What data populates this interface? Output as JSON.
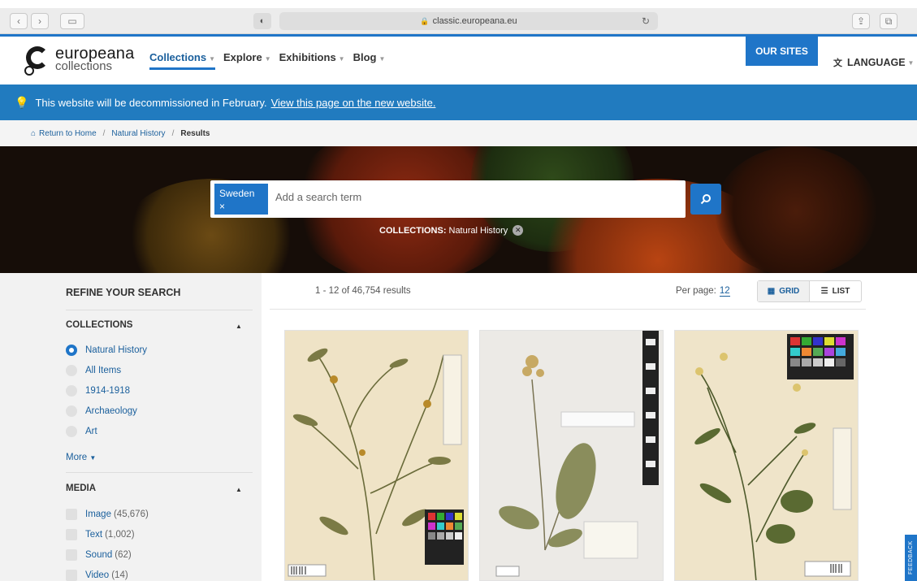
{
  "browser": {
    "url": "classic.europeana.eu",
    "back_icon": "chevron-left-icon",
    "forward_icon": "chevron-right-icon"
  },
  "header": {
    "logo_line1": "europeana",
    "logo_line2": "collections",
    "nav": [
      {
        "label": "Collections"
      },
      {
        "label": "Explore"
      },
      {
        "label": "Exhibitions"
      },
      {
        "label": "Blog"
      }
    ],
    "our_sites": "OUR SITES",
    "language": "LANGUAGE"
  },
  "banner": {
    "text": "This website will be decommissioned in February.",
    "link": "View this page on the new website."
  },
  "breadcrumb": {
    "home": "Return to Home",
    "section": "Natural History",
    "current": "Results"
  },
  "search": {
    "tag": "Sweden",
    "tag_close": "×",
    "placeholder": "Add a search term",
    "filter_label": "COLLECTIONS:",
    "filter_value": "Natural History"
  },
  "sidebar": {
    "refine_title": "REFINE YOUR SEARCH",
    "collections_title": "COLLECTIONS",
    "collections": [
      {
        "label": "Natural History",
        "selected": true
      },
      {
        "label": "All Items",
        "selected": false
      },
      {
        "label": "1914-1918",
        "selected": false
      },
      {
        "label": "Archaeology",
        "selected": false
      },
      {
        "label": "Art",
        "selected": false
      }
    ],
    "more": "More",
    "media_title": "MEDIA",
    "media": [
      {
        "label": "Image",
        "count": "(45,676)"
      },
      {
        "label": "Text",
        "count": "(1,002)"
      },
      {
        "label": "Sound",
        "count": "(62)"
      },
      {
        "label": "Video",
        "count": "(14)"
      }
    ]
  },
  "results": {
    "count_text": "1 - 12 of 46,754 results",
    "per_page_label": "Per page:",
    "per_page_value": "12",
    "grid_label": "GRID",
    "list_label": "LIST"
  },
  "feedback": "FEEDBACK",
  "colors": {
    "accent": "#1f75c8",
    "banner": "#217bbf",
    "link": "#1a5f9c"
  }
}
